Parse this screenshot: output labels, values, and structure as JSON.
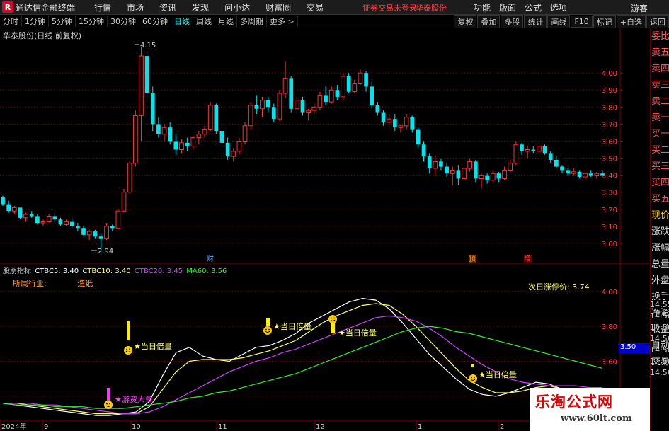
{
  "app": {
    "title": "通达信金融终端",
    "logo_glyph": "R",
    "menu": [
      "行情",
      "市场",
      "资讯",
      "发现",
      "问小达",
      "财富圈",
      "交易"
    ],
    "login_status": "证券交易未登录",
    "stock_name": "华泰股份",
    "right_menu": [
      "功能",
      "版面",
      "公式",
      "选项"
    ],
    "guest": "游客"
  },
  "toolbar": {
    "periods": [
      "分时",
      "1分钟",
      "5分钟",
      "15分钟",
      "30分钟",
      "60分钟",
      "日线",
      "周线",
      "月线",
      "多周期",
      "更多"
    ],
    "active": "日线",
    "more_chevron": ">",
    "right_tools": [
      "复权",
      "叠加",
      "多股",
      "统计",
      "画线",
      "F10",
      "标记",
      "+自选",
      "返回"
    ]
  },
  "price_panel": {
    "title": "华泰股份(日线 前复权)",
    "high_label": "4.15",
    "low_label": "2.94",
    "axis_ticks": [
      "4.00",
      "3.90",
      "3.80",
      "3.70",
      "3.60",
      "3.50",
      "3.40",
      "3.30",
      "3.20",
      "3.10",
      "3.00"
    ],
    "markers": [
      {
        "text": "财",
        "color": "#4d9cff"
      },
      {
        "text": "预",
        "color": "#ff9933"
      },
      {
        "text": "增",
        "color": "#ff5555"
      }
    ]
  },
  "indicator": {
    "name": "股朋指标",
    "legend": [
      {
        "label": "CTBC5: 3.40",
        "color": "#ffffff"
      },
      {
        "label": "CTBC10: 3.40",
        "color": "#ffff66"
      },
      {
        "label": "CTBC20: 3.45",
        "color": "#cc44ff"
      },
      {
        "label": "MA60: 3.56",
        "color": "#33ee33"
      }
    ],
    "industry_label": "所属行业:",
    "industry_value": "造纸",
    "limit_label": "次日涨停价: 3.74",
    "axis_ticks": [
      "4.00",
      "3.80",
      "3.60",
      "3.40"
    ],
    "current_tag": "3.50",
    "signals": [
      "★当日倍量",
      "★当日倍量",
      "★当日倍量",
      "★当日倍量"
    ],
    "signal_big": "★游资大单"
  },
  "time_axis": {
    "labels": [
      "2024年",
      "9",
      "10",
      "11",
      "12",
      "1",
      "2"
    ]
  },
  "quote_panel": {
    "items": [
      "委比",
      "卖五",
      "卖四",
      "卖三",
      "卖二",
      "卖一",
      "买一",
      "买二",
      "买三",
      "买四",
      "买五",
      "现价",
      "涨跌",
      "涨幅",
      "总量",
      "外盘",
      "换手",
      "净资",
      "收益",
      "自动",
      "交易"
    ],
    "times": [
      "14:55",
      "14:56",
      "14:56",
      "14:56",
      "14:56",
      "14:56",
      "14:56"
    ]
  },
  "watermark": {
    "title": "乐淘公式网",
    "url": "www.60lt.com"
  },
  "colors": {
    "up": "#ff3333",
    "down": "#00e5ee",
    "grid": "#7a0000",
    "bg": "#000000"
  },
  "chart_data": {
    "type": "candlestick",
    "title": "华泰股份(日线 前复权)",
    "ylim": [
      2.9,
      4.2
    ],
    "candles": [
      [
        3.27,
        3.28,
        3.22,
        3.23
      ],
      [
        3.23,
        3.25,
        3.18,
        3.19
      ],
      [
        3.19,
        3.22,
        3.17,
        3.21
      ],
      [
        3.21,
        3.21,
        3.14,
        3.15
      ],
      [
        3.15,
        3.18,
        3.13,
        3.17
      ],
      [
        3.17,
        3.19,
        3.15,
        3.16
      ],
      [
        3.16,
        3.17,
        3.11,
        3.12
      ],
      [
        3.12,
        3.14,
        3.1,
        3.13
      ],
      [
        3.13,
        3.17,
        3.12,
        3.16
      ],
      [
        3.16,
        3.18,
        3.13,
        3.14
      ],
      [
        3.14,
        3.15,
        3.1,
        3.11
      ],
      [
        3.11,
        3.14,
        3.1,
        3.13
      ],
      [
        3.13,
        3.15,
        3.09,
        3.1
      ],
      [
        3.1,
        3.12,
        3.07,
        3.09
      ],
      [
        3.09,
        3.1,
        3.04,
        3.05
      ],
      [
        3.05,
        3.08,
        3.02,
        3.07
      ],
      [
        3.07,
        3.08,
        3.03,
        3.04
      ],
      [
        3.04,
        3.06,
        2.94,
        3.03
      ],
      [
        3.03,
        3.12,
        3.02,
        3.1
      ],
      [
        3.1,
        3.11,
        3.07,
        3.09
      ],
      [
        3.09,
        3.2,
        3.08,
        3.19
      ],
      [
        3.19,
        3.32,
        3.18,
        3.3
      ],
      [
        3.3,
        3.48,
        3.29,
        3.47
      ],
      [
        3.47,
        3.78,
        3.45,
        3.75
      ],
      [
        3.75,
        4.15,
        3.6,
        4.1
      ],
      [
        4.1,
        4.12,
        3.85,
        3.88
      ],
      [
        3.88,
        3.92,
        3.66,
        3.7
      ],
      [
        3.7,
        3.74,
        3.62,
        3.64
      ],
      [
        3.64,
        3.7,
        3.6,
        3.68
      ],
      [
        3.68,
        3.71,
        3.58,
        3.6
      ],
      [
        3.6,
        3.64,
        3.52,
        3.55
      ],
      [
        3.55,
        3.61,
        3.53,
        3.59
      ],
      [
        3.59,
        3.62,
        3.54,
        3.57
      ],
      [
        3.57,
        3.63,
        3.55,
        3.62
      ],
      [
        3.62,
        3.66,
        3.58,
        3.64
      ],
      [
        3.64,
        3.69,
        3.62,
        3.67
      ],
      [
        3.67,
        3.83,
        3.66,
        3.81
      ],
      [
        3.81,
        3.82,
        3.64,
        3.66
      ],
      [
        3.66,
        3.67,
        3.57,
        3.59
      ],
      [
        3.59,
        3.62,
        3.49,
        3.51
      ],
      [
        3.51,
        3.56,
        3.48,
        3.54
      ],
      [
        3.54,
        3.62,
        3.52,
        3.6
      ],
      [
        3.6,
        3.71,
        3.58,
        3.69
      ],
      [
        3.69,
        3.83,
        3.67,
        3.81
      ],
      [
        3.81,
        3.87,
        3.76,
        3.79
      ],
      [
        3.79,
        3.86,
        3.74,
        3.84
      ],
      [
        3.84,
        3.86,
        3.77,
        3.8
      ],
      [
        3.8,
        3.82,
        3.71,
        3.73
      ],
      [
        3.73,
        3.9,
        3.72,
        3.88
      ],
      [
        3.88,
        4.07,
        3.85,
        3.97
      ],
      [
        3.97,
        3.98,
        3.77,
        3.79
      ],
      [
        3.79,
        3.86,
        3.77,
        3.84
      ],
      [
        3.84,
        3.86,
        3.75,
        3.77
      ],
      [
        3.77,
        3.79,
        3.72,
        3.78
      ],
      [
        3.78,
        3.82,
        3.76,
        3.8
      ],
      [
        3.8,
        3.89,
        3.78,
        3.87
      ],
      [
        3.87,
        3.92,
        3.81,
        3.83
      ],
      [
        3.83,
        3.92,
        3.82,
        3.9
      ],
      [
        3.9,
        3.93,
        3.84,
        3.86
      ],
      [
        3.86,
        4.0,
        3.84,
        3.98
      ],
      [
        3.98,
        4.0,
        3.88,
        3.89
      ],
      [
        3.89,
        3.96,
        3.88,
        3.94
      ],
      [
        3.94,
        4.02,
        3.93,
        4.0
      ],
      [
        4.0,
        4.01,
        3.89,
        3.92
      ],
      [
        3.92,
        3.95,
        3.79,
        3.81
      ],
      [
        3.81,
        3.83,
        3.75,
        3.77
      ],
      [
        3.77,
        3.78,
        3.69,
        3.71
      ],
      [
        3.71,
        3.76,
        3.67,
        3.73
      ],
      [
        3.73,
        3.76,
        3.66,
        3.68
      ],
      [
        3.68,
        3.7,
        3.65,
        3.69
      ],
      [
        3.69,
        3.76,
        3.67,
        3.74
      ],
      [
        3.74,
        3.75,
        3.65,
        3.67
      ],
      [
        3.67,
        3.68,
        3.56,
        3.58
      ],
      [
        3.58,
        3.6,
        3.48,
        3.51
      ],
      [
        3.51,
        3.53,
        3.41,
        3.44
      ],
      [
        3.44,
        3.51,
        3.4,
        3.48
      ],
      [
        3.48,
        3.5,
        3.43,
        3.45
      ],
      [
        3.45,
        3.47,
        3.39,
        3.41
      ],
      [
        3.41,
        3.45,
        3.34,
        3.43
      ],
      [
        3.43,
        3.46,
        3.34,
        3.38
      ],
      [
        3.38,
        3.46,
        3.37,
        3.44
      ],
      [
        3.44,
        3.5,
        3.42,
        3.48
      ],
      [
        3.48,
        3.49,
        3.36,
        3.38
      ],
      [
        3.38,
        3.41,
        3.32,
        3.4
      ],
      [
        3.4,
        3.41,
        3.35,
        3.37
      ],
      [
        3.37,
        3.43,
        3.36,
        3.41
      ],
      [
        3.41,
        3.42,
        3.36,
        3.38
      ],
      [
        3.38,
        3.45,
        3.37,
        3.43
      ],
      [
        3.43,
        3.49,
        3.42,
        3.47
      ],
      [
        3.47,
        3.6,
        3.46,
        3.58
      ],
      [
        3.58,
        3.59,
        3.52,
        3.54
      ],
      [
        3.54,
        3.57,
        3.5,
        3.55
      ],
      [
        3.55,
        3.57,
        3.53,
        3.54
      ],
      [
        3.54,
        3.58,
        3.53,
        3.57
      ],
      [
        3.57,
        3.58,
        3.52,
        3.53
      ],
      [
        3.53,
        3.54,
        3.47,
        3.49
      ],
      [
        3.49,
        3.51,
        3.44,
        3.45
      ],
      [
        3.45,
        3.46,
        3.41,
        3.43
      ],
      [
        3.43,
        3.44,
        3.4,
        3.41
      ],
      [
        3.41,
        3.44,
        3.4,
        3.42
      ],
      [
        3.42,
        3.43,
        3.38,
        3.39
      ],
      [
        3.39,
        3.42,
        3.38,
        3.41
      ],
      [
        3.41,
        3.43,
        3.39,
        3.4
      ],
      [
        3.4,
        3.42,
        3.38,
        3.41
      ],
      [
        3.41,
        3.43,
        3.39,
        3.4
      ]
    ],
    "indicator_ylim": [
      3.27,
      4.08
    ],
    "series": [
      {
        "name": "CTBC5",
        "color": "#ffffff",
        "values": [
          3.36,
          3.35,
          3.34,
          3.33,
          3.32,
          3.31,
          3.3,
          3.29,
          3.29,
          3.3,
          3.31,
          3.37,
          3.52,
          3.65,
          3.68,
          3.63,
          3.61,
          3.6,
          3.64,
          3.68,
          3.69,
          3.72,
          3.76,
          3.82,
          3.86,
          3.9,
          3.94,
          3.96,
          3.95,
          3.9,
          3.82,
          3.73,
          3.64,
          3.57,
          3.5,
          3.44,
          3.41,
          3.4,
          3.42,
          3.45,
          3.48,
          3.47,
          3.44,
          3.41,
          3.4,
          3.4
        ]
      },
      {
        "name": "CTBC10",
        "color": "#ffff66",
        "values": [
          3.36,
          3.36,
          3.35,
          3.34,
          3.33,
          3.32,
          3.31,
          3.3,
          3.3,
          3.3,
          3.3,
          3.34,
          3.44,
          3.54,
          3.6,
          3.61,
          3.61,
          3.61,
          3.62,
          3.64,
          3.66,
          3.69,
          3.72,
          3.77,
          3.82,
          3.86,
          3.89,
          3.92,
          3.93,
          3.92,
          3.87,
          3.8,
          3.72,
          3.64,
          3.56,
          3.49,
          3.45,
          3.42,
          3.42,
          3.43,
          3.45,
          3.46,
          3.44,
          3.42,
          3.41,
          3.4
        ]
      },
      {
        "name": "CTBC20",
        "color": "#cc44ff",
        "values": [
          3.36,
          3.36,
          3.36,
          3.35,
          3.35,
          3.34,
          3.33,
          3.32,
          3.31,
          3.3,
          3.3,
          3.31,
          3.34,
          3.38,
          3.42,
          3.46,
          3.5,
          3.54,
          3.57,
          3.6,
          3.62,
          3.65,
          3.67,
          3.7,
          3.73,
          3.76,
          3.79,
          3.82,
          3.85,
          3.86,
          3.85,
          3.83,
          3.79,
          3.74,
          3.68,
          3.63,
          3.58,
          3.54,
          3.5,
          3.48,
          3.47,
          3.46,
          3.46,
          3.46,
          3.45,
          3.45
        ]
      },
      {
        "name": "MA60",
        "color": "#33ee33",
        "values": [
          3.36,
          3.35,
          3.35,
          3.35,
          3.34,
          3.34,
          3.34,
          3.33,
          3.33,
          3.33,
          3.34,
          3.35,
          3.36,
          3.37,
          3.39,
          3.4,
          3.42,
          3.43,
          3.45,
          3.47,
          3.49,
          3.51,
          3.53,
          3.56,
          3.59,
          3.62,
          3.65,
          3.68,
          3.71,
          3.74,
          3.77,
          3.79,
          3.8,
          3.79,
          3.77,
          3.76,
          3.74,
          3.72,
          3.7,
          3.68,
          3.66,
          3.64,
          3.62,
          3.6,
          3.58,
          3.56
        ]
      }
    ]
  }
}
